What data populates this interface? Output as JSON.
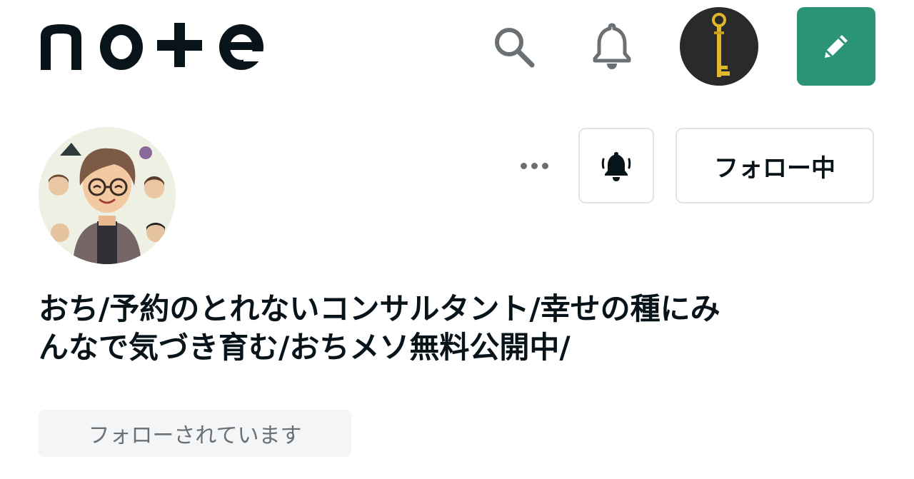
{
  "header": {
    "logo_text": "note",
    "icons": {
      "search": "search-icon",
      "notifications": "bell-icon",
      "post": "pencil-icon"
    },
    "user_avatar": "key-avatar"
  },
  "profile": {
    "avatar": "illustrated-character-avatar",
    "actions": {
      "more": "more-options-icon",
      "notify": "bell-filled-icon",
      "follow_label": "フォロー中"
    },
    "name_lines": [
      "おち/予約のとれないコンサルタント/幸せの種にみ",
      "んなで気づき育む/おちメソ無料公開中/"
    ],
    "follows_you_label": "フォローされています"
  },
  "colors": {
    "accent": "#2b9476",
    "text": "#08131a",
    "muted_text": "#6b7074",
    "badge_bg": "#f3f5f7",
    "button_border": "#dfe3e6"
  }
}
